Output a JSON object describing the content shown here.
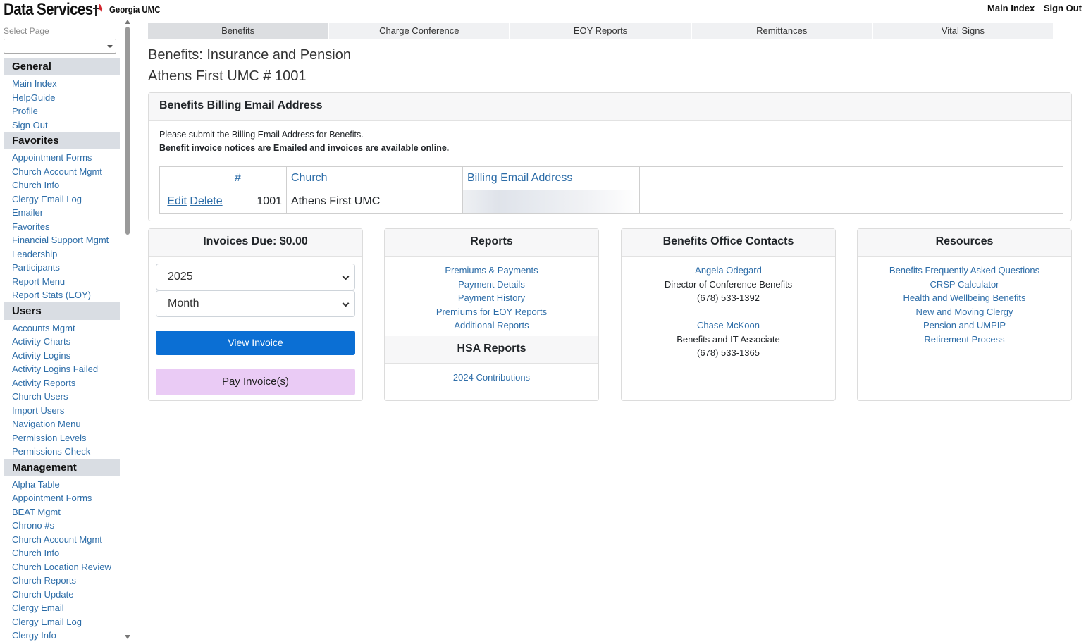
{
  "header": {
    "brand": "Data Services",
    "org": "Georgia UMC",
    "links": [
      "Main Index",
      "Sign Out"
    ]
  },
  "sidebar": {
    "select_label": "Select Page",
    "groups": [
      {
        "title": "General",
        "items": [
          "Main Index",
          "HelpGuide",
          "Profile",
          "Sign Out"
        ]
      },
      {
        "title": "Favorites",
        "items": [
          "Appointment Forms",
          "Church Account Mgmt",
          "Church Info",
          "Clergy Email Log",
          "Emailer",
          "Favorites",
          "Financial Support Mgmt",
          "Leadership",
          "Participants",
          "Report Menu",
          "Report Stats (EOY)"
        ]
      },
      {
        "title": "Users",
        "items": [
          "Accounts Mgmt",
          "Activity Charts",
          "Activity Logins",
          "Activity Logins Failed",
          "Activity Reports",
          "Church Users",
          "Import Users",
          "Navigation Menu",
          "Permission Levels",
          "Permissions Check"
        ]
      },
      {
        "title": "Management",
        "items": [
          "Alpha Table",
          "Appointment Forms",
          "BEAT Mgmt",
          "Chrono #s",
          "Church Account Mgmt",
          "Church Info",
          "Church Location Review",
          "Church Reports",
          "Church Update",
          "Clergy Email",
          "Clergy Email Log",
          "Clergy Info"
        ]
      }
    ]
  },
  "tabs": [
    "Benefits",
    "Charge Conference",
    "EOY Reports",
    "Remittances",
    "Vital Signs"
  ],
  "page": {
    "title": "Benefits: Insurance and Pension",
    "subtitle": "Athens First UMC # 1001"
  },
  "billing": {
    "title": "Benefits Billing Email Address",
    "note1": "Please submit the Billing Email Address for Benefits.",
    "note2": "Benefit invoice notices are Emailed and invoices are available online.",
    "columns": [
      "#",
      "Church",
      "Billing Email Address"
    ],
    "row": {
      "edit": "Edit",
      "delete": "Delete",
      "number": "1001",
      "church": "Athens First UMC"
    }
  },
  "invoices": {
    "title": "Invoices Due: $0.00",
    "year": "2025",
    "month": "Month",
    "view_label": "View Invoice",
    "pay_label": "Pay Invoice(s)"
  },
  "reports": {
    "title": "Reports",
    "links": [
      "Premiums & Payments",
      "Payment Details",
      "Payment History",
      "Premiums for EOY Reports",
      "Additional Reports"
    ],
    "hsa_title": "HSA Reports",
    "hsa_links": [
      "2024 Contributions"
    ]
  },
  "contacts": {
    "title": "Benefits Office Contacts",
    "people": [
      {
        "name": "Angela Odegard",
        "role": "Director of Conference Benefits",
        "phone": "(678) 533-1392"
      },
      {
        "name": "Chase McKoon",
        "role": "Benefits and IT Associate",
        "phone": "(678) 533-1365"
      }
    ]
  },
  "resources": {
    "title": "Resources",
    "links": [
      "Benefits Frequently Asked Questions",
      "CRSP Calculator",
      "Health and Wellbeing Benefits",
      "New and Moving Clergy",
      "Pension and UMPIP",
      "Retirement Process"
    ]
  },
  "colors": {
    "link": "#2d6da8",
    "primary": "#0b6fd4",
    "pay": "#eacbf5",
    "group_bg": "#d9dde3"
  }
}
